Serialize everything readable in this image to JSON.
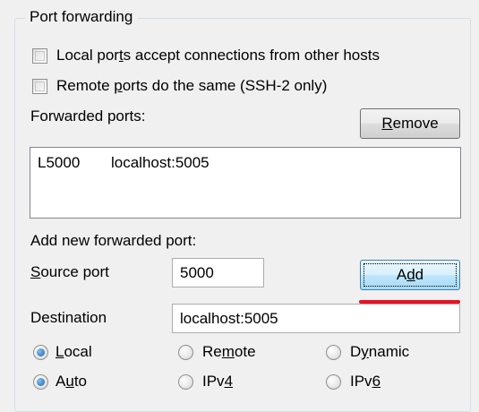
{
  "group": {
    "title": "Port forwarding"
  },
  "options": {
    "local_ports_accept": {
      "pre": "Local por",
      "accel": "t",
      "post": "s accept connections from other hosts",
      "checked": false
    },
    "remote_ports_same": {
      "pre": "Remote ",
      "accel": "p",
      "post": "orts do the same (SSH-2 only)",
      "checked": false
    }
  },
  "forwarded": {
    "label": "Forwarded ports:",
    "remove_button": {
      "pre": "",
      "accel": "R",
      "post": "emove"
    },
    "rows": [
      {
        "port": "L5000",
        "target": "localhost:5005"
      }
    ]
  },
  "add_new": {
    "label": "Add new forwarded port:",
    "source_port": {
      "label_accel": "S",
      "label_rest": "ource port",
      "value": "5000"
    },
    "destination": {
      "label": "Destination",
      "value": "localhost:5005"
    },
    "add_button": {
      "pre": "A",
      "accel": "d",
      "post": "d"
    },
    "direction": [
      {
        "pre": "",
        "accel": "L",
        "post": "ocal",
        "selected": true
      },
      {
        "pre": "Re",
        "accel": "m",
        "post": "ote",
        "selected": false
      },
      {
        "pre": "D",
        "accel": "y",
        "post": "namic",
        "selected": false
      }
    ],
    "protocol": [
      {
        "pre": "A",
        "accel": "u",
        "post": "to",
        "selected": true
      },
      {
        "pre": "IPv",
        "accel": "4",
        "post": "",
        "selected": false
      },
      {
        "pre": "IPv",
        "accel": "6",
        "post": "",
        "selected": false
      }
    ]
  },
  "colors": {
    "highlight_underline": "#e81123",
    "radio_selected": "#1c5fa8"
  }
}
